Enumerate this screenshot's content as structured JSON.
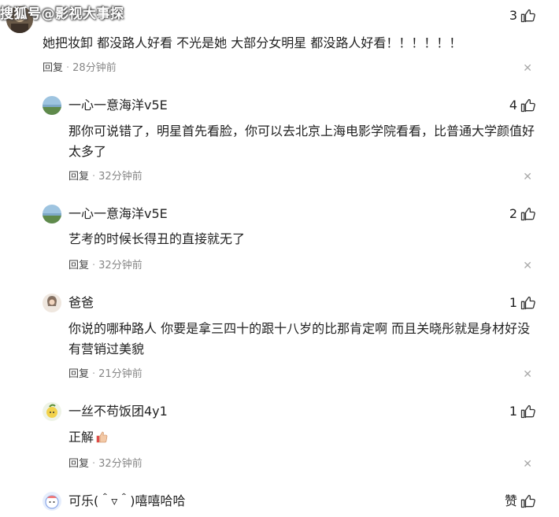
{
  "watermark": "搜狐号@影视大事探",
  "comments": [
    {
      "username": "",
      "likes": "3",
      "content": "她把妆卸 都没路人好看 不光是她 大部分女明星 都没路人好看！！！！！！",
      "reply_label": "回复",
      "time": "28分钟前",
      "close": "✕"
    },
    {
      "username": "一心一意海洋v5E",
      "likes": "4",
      "content": "那你可说错了，明星首先看脸，你可以去北京上海电影学院看看，比普通大学颜值好太多了",
      "reply_label": "回复",
      "time": "32分钟前",
      "close": "✕"
    },
    {
      "username": "一心一意海洋v5E",
      "likes": "2",
      "content": "艺考的时候长得丑的直接就无了",
      "reply_label": "回复",
      "time": "32分钟前",
      "close": "✕"
    },
    {
      "username": "爸爸",
      "likes": "1",
      "content": "你说的哪种路人 你要是拿三四十的跟十八岁的比那肯定啊 而且关晓彤就是身材好没有营销过美貌",
      "reply_label": "回复",
      "time": "21分钟前",
      "close": "✕"
    },
    {
      "username": "一丝不苟饭团4y1",
      "likes": "1",
      "content": "正解",
      "reply_label": "回复",
      "time": "32分钟前",
      "close": "✕"
    },
    {
      "username": "可乐(＾▿＾)嘻嘻哈哈",
      "likes": "赞",
      "content": "",
      "reply_label": "",
      "time": "",
      "close": ""
    }
  ]
}
